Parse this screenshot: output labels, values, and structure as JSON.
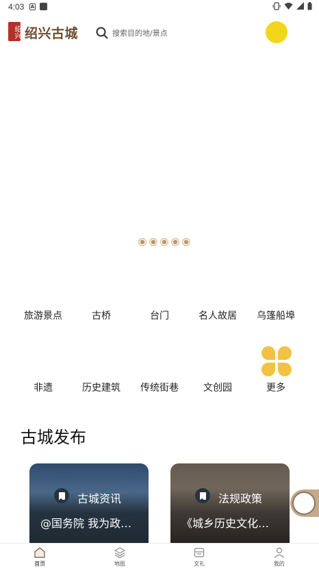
{
  "status_bar": {
    "time": "4:03"
  },
  "header": {
    "logo_seal": "绍兴",
    "logo_text": "绍兴古城",
    "search_placeholder": "搜索目的地/景点"
  },
  "categories": [
    {
      "label": "旅游景点"
    },
    {
      "label": "古桥"
    },
    {
      "label": "台门"
    },
    {
      "label": "名人故居"
    },
    {
      "label": "乌篷船埠"
    },
    {
      "label": "非遗"
    },
    {
      "label": "历史建筑"
    },
    {
      "label": "传统街巷"
    },
    {
      "label": "文创园"
    },
    {
      "label": "更多"
    }
  ],
  "section": {
    "title": "古城发布"
  },
  "cards": [
    {
      "tag": "古城资讯",
      "desc": "@国务院 我为政…"
    },
    {
      "tag": "法规政策",
      "desc": "《城乡历史文化…"
    }
  ],
  "bottom_nav": [
    {
      "label": "首页",
      "icon": "home-icon"
    },
    {
      "label": "地图",
      "icon": "layers-icon"
    },
    {
      "label": "文礼",
      "icon": "gift-icon"
    },
    {
      "label": "我的",
      "icon": "person-icon"
    }
  ],
  "colors": {
    "accent": "#b8956a",
    "avatar": "#f2d61a",
    "more_icon": "#f3c245"
  }
}
